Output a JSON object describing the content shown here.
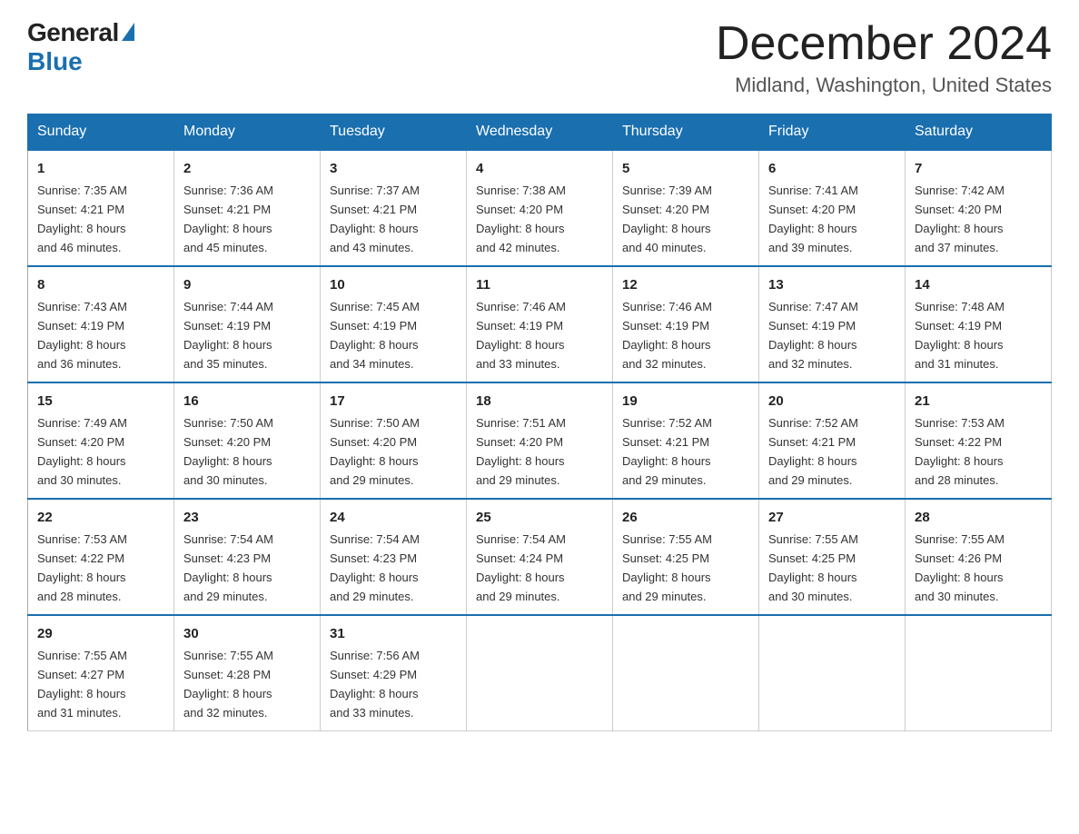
{
  "header": {
    "logo_general": "General",
    "logo_blue": "Blue",
    "month_title": "December 2024",
    "location": "Midland, Washington, United States"
  },
  "weekdays": [
    "Sunday",
    "Monday",
    "Tuesday",
    "Wednesday",
    "Thursday",
    "Friday",
    "Saturday"
  ],
  "weeks": [
    [
      {
        "day": "1",
        "sunrise": "7:35 AM",
        "sunset": "4:21 PM",
        "daylight": "8 hours and 46 minutes."
      },
      {
        "day": "2",
        "sunrise": "7:36 AM",
        "sunset": "4:21 PM",
        "daylight": "8 hours and 45 minutes."
      },
      {
        "day": "3",
        "sunrise": "7:37 AM",
        "sunset": "4:21 PM",
        "daylight": "8 hours and 43 minutes."
      },
      {
        "day": "4",
        "sunrise": "7:38 AM",
        "sunset": "4:20 PM",
        "daylight": "8 hours and 42 minutes."
      },
      {
        "day": "5",
        "sunrise": "7:39 AM",
        "sunset": "4:20 PM",
        "daylight": "8 hours and 40 minutes."
      },
      {
        "day": "6",
        "sunrise": "7:41 AM",
        "sunset": "4:20 PM",
        "daylight": "8 hours and 39 minutes."
      },
      {
        "day": "7",
        "sunrise": "7:42 AM",
        "sunset": "4:20 PM",
        "daylight": "8 hours and 37 minutes."
      }
    ],
    [
      {
        "day": "8",
        "sunrise": "7:43 AM",
        "sunset": "4:19 PM",
        "daylight": "8 hours and 36 minutes."
      },
      {
        "day": "9",
        "sunrise": "7:44 AM",
        "sunset": "4:19 PM",
        "daylight": "8 hours and 35 minutes."
      },
      {
        "day": "10",
        "sunrise": "7:45 AM",
        "sunset": "4:19 PM",
        "daylight": "8 hours and 34 minutes."
      },
      {
        "day": "11",
        "sunrise": "7:46 AM",
        "sunset": "4:19 PM",
        "daylight": "8 hours and 33 minutes."
      },
      {
        "day": "12",
        "sunrise": "7:46 AM",
        "sunset": "4:19 PM",
        "daylight": "8 hours and 32 minutes."
      },
      {
        "day": "13",
        "sunrise": "7:47 AM",
        "sunset": "4:19 PM",
        "daylight": "8 hours and 32 minutes."
      },
      {
        "day": "14",
        "sunrise": "7:48 AM",
        "sunset": "4:19 PM",
        "daylight": "8 hours and 31 minutes."
      }
    ],
    [
      {
        "day": "15",
        "sunrise": "7:49 AM",
        "sunset": "4:20 PM",
        "daylight": "8 hours and 30 minutes."
      },
      {
        "day": "16",
        "sunrise": "7:50 AM",
        "sunset": "4:20 PM",
        "daylight": "8 hours and 30 minutes."
      },
      {
        "day": "17",
        "sunrise": "7:50 AM",
        "sunset": "4:20 PM",
        "daylight": "8 hours and 29 minutes."
      },
      {
        "day": "18",
        "sunrise": "7:51 AM",
        "sunset": "4:20 PM",
        "daylight": "8 hours and 29 minutes."
      },
      {
        "day": "19",
        "sunrise": "7:52 AM",
        "sunset": "4:21 PM",
        "daylight": "8 hours and 29 minutes."
      },
      {
        "day": "20",
        "sunrise": "7:52 AM",
        "sunset": "4:21 PM",
        "daylight": "8 hours and 29 minutes."
      },
      {
        "day": "21",
        "sunrise": "7:53 AM",
        "sunset": "4:22 PM",
        "daylight": "8 hours and 28 minutes."
      }
    ],
    [
      {
        "day": "22",
        "sunrise": "7:53 AM",
        "sunset": "4:22 PM",
        "daylight": "8 hours and 28 minutes."
      },
      {
        "day": "23",
        "sunrise": "7:54 AM",
        "sunset": "4:23 PM",
        "daylight": "8 hours and 29 minutes."
      },
      {
        "day": "24",
        "sunrise": "7:54 AM",
        "sunset": "4:23 PM",
        "daylight": "8 hours and 29 minutes."
      },
      {
        "day": "25",
        "sunrise": "7:54 AM",
        "sunset": "4:24 PM",
        "daylight": "8 hours and 29 minutes."
      },
      {
        "day": "26",
        "sunrise": "7:55 AM",
        "sunset": "4:25 PM",
        "daylight": "8 hours and 29 minutes."
      },
      {
        "day": "27",
        "sunrise": "7:55 AM",
        "sunset": "4:25 PM",
        "daylight": "8 hours and 30 minutes."
      },
      {
        "day": "28",
        "sunrise": "7:55 AM",
        "sunset": "4:26 PM",
        "daylight": "8 hours and 30 minutes."
      }
    ],
    [
      {
        "day": "29",
        "sunrise": "7:55 AM",
        "sunset": "4:27 PM",
        "daylight": "8 hours and 31 minutes."
      },
      {
        "day": "30",
        "sunrise": "7:55 AM",
        "sunset": "4:28 PM",
        "daylight": "8 hours and 32 minutes."
      },
      {
        "day": "31",
        "sunrise": "7:56 AM",
        "sunset": "4:29 PM",
        "daylight": "8 hours and 33 minutes."
      },
      null,
      null,
      null,
      null
    ]
  ],
  "labels": {
    "sunrise": "Sunrise:",
    "sunset": "Sunset:",
    "daylight": "Daylight:"
  }
}
